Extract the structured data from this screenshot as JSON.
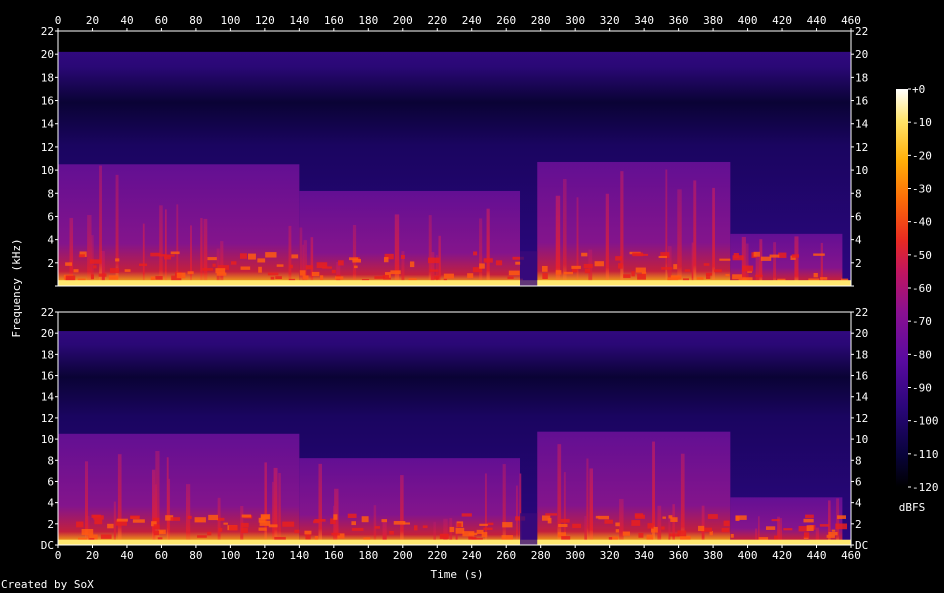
{
  "chart_data": {
    "type": "heatmap",
    "xlabel": "Time (s)",
    "ylabel": "Frequency (kHz)",
    "x_ticks": [
      "0",
      "20",
      "40",
      "60",
      "80",
      "100",
      "120",
      "140",
      "160",
      "180",
      "200",
      "220",
      "240",
      "260",
      "280",
      "300",
      "320",
      "340",
      "360",
      "380",
      "400",
      "420",
      "440",
      "460"
    ],
    "xlim": [
      0,
      460
    ],
    "ylim_khz": [
      0,
      22
    ],
    "y_ticks_top": [
      "22",
      "20",
      "18",
      "16",
      "14",
      "12",
      "10",
      "8",
      "6",
      "4",
      "2"
    ],
    "y_ticks_bottom": [
      "DC",
      "2",
      "4",
      "6",
      "8",
      "10",
      "12",
      "14",
      "16",
      "18",
      "20",
      "22"
    ],
    "channels": 2,
    "colorbar": {
      "label": "dBFS",
      "ticks": [
        "+0",
        "-10",
        "-20",
        "-30",
        "-40",
        "-50",
        "-60",
        "-70",
        "-80",
        "-90",
        "-100",
        "-110",
        "-120"
      ],
      "range_db": [
        -120,
        0
      ]
    },
    "segments": [
      {
        "start": 0,
        "end": 140,
        "bandwidth_khz": 10.5
      },
      {
        "start": 140,
        "end": 268,
        "bandwidth_khz": 8.2
      },
      {
        "start": 278,
        "end": 390,
        "bandwidth_khz": 10.7
      },
      {
        "start": 390,
        "end": 455,
        "bandwidth_khz": 4.5
      }
    ],
    "colors": [
      "#000000",
      "#0a0340",
      "#2a067a",
      "#5a0aa0",
      "#8a1090",
      "#c01560",
      "#e82a22",
      "#fb6a08",
      "#ffae08",
      "#ffe46a",
      "#ffffff"
    ]
  },
  "footer": {
    "credit": "Created by SoX"
  }
}
